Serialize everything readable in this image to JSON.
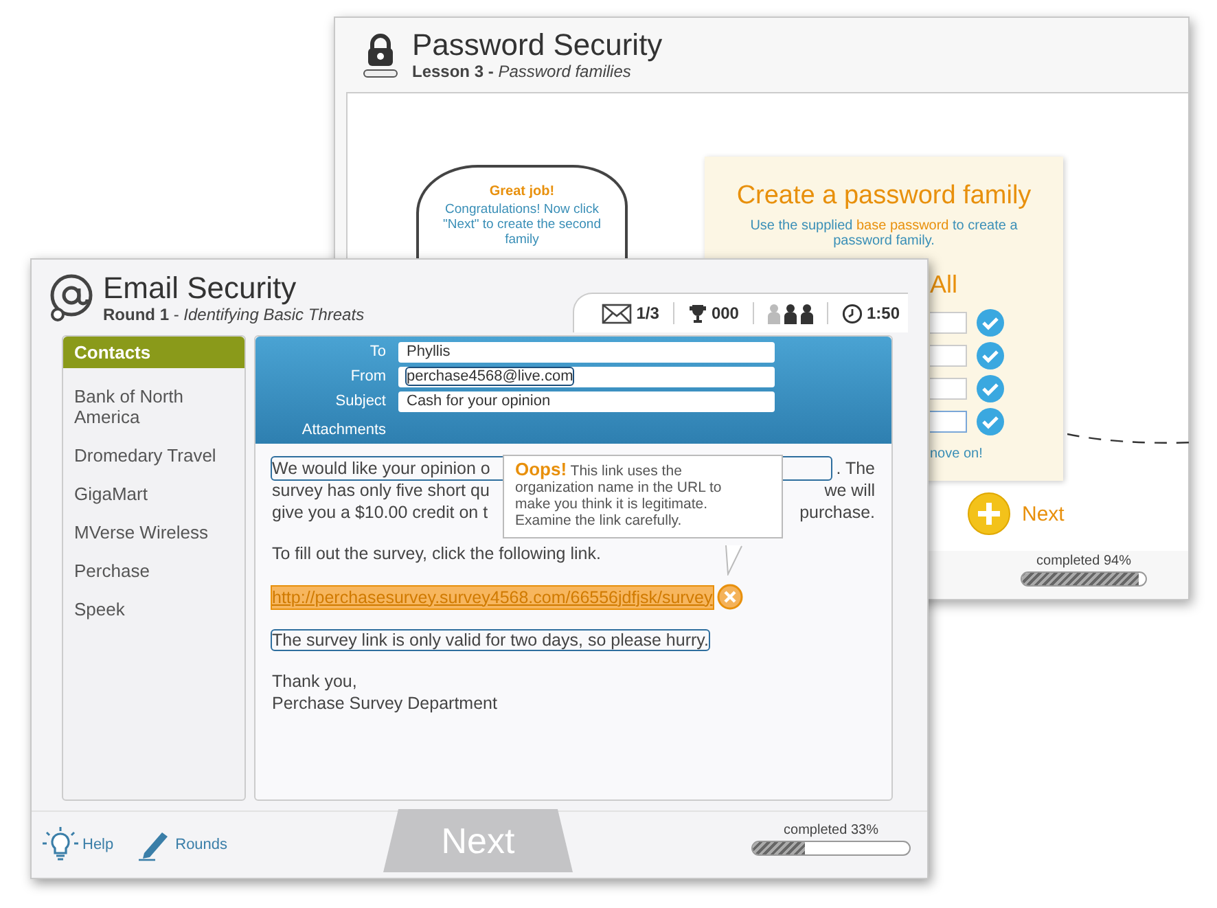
{
  "password_window": {
    "title": "Password Security",
    "subtitle": "**Lesson 3 -** *Password families*",
    "bubble": {
      "heading": "Great job!",
      "text": "Congratulations! Now click \"Next\" to create the second family"
    },
    "panel": {
      "title": "Create a password family",
      "instruction": [
        {
          "kind": "plain",
          "text": "Use the supplied "
        },
        {
          "kind": "term",
          "text": "base password"
        },
        {
          "kind": "plain",
          "text": " to create a password family."
        }
      ],
      "heading_fragment": "All",
      "inputs": [
        {
          "checked": true,
          "focused": false
        },
        {
          "checked": true,
          "focused": false
        },
        {
          "checked": true,
          "focused": false
        },
        {
          "checked": true,
          "focused": true
        }
      ],
      "note_fragment": "nove on!"
    },
    "next_button": "Next",
    "progress": {
      "label": "completed 94%",
      "level": 0.94
    }
  },
  "email_window": {
    "title": "Email Security",
    "subtitle": "**Round 1** - *Identifying Basic Threats*",
    "stats": [
      {
        "kind": "messages",
        "value": "1/3"
      },
      {
        "kind": "score",
        "value": "000"
      },
      {
        "kind": "lives",
        "lives": [
          {
            "active": false
          },
          {
            "active": true
          },
          {
            "active": true
          }
        ]
      },
      {
        "kind": "timer",
        "value": "1:50"
      }
    ],
    "contacts": {
      "header": "Contacts",
      "items": [
        {
          "name": "Bank of North America",
          "selected": false
        },
        {
          "name": "Dromedary Travel",
          "selected": false
        },
        {
          "name": "GigaMart",
          "selected": false
        },
        {
          "name": "MVerse Wireless",
          "selected": false
        },
        {
          "name": "Perchase",
          "selected": false
        },
        {
          "name": "Speek",
          "selected": false
        }
      ]
    },
    "fields": [
      {
        "kind": "field",
        "label": "To",
        "value": "Phyllis",
        "flagged": false
      },
      {
        "kind": "field",
        "label": "From",
        "value": "perchase4568@live.com",
        "flagged": true
      },
      {
        "kind": "field",
        "label": "Subject",
        "value": "Cash for your opinion",
        "flagged": false
      },
      {
        "kind": "label",
        "label": "Attachments"
      }
    ],
    "body": [
      {
        "kind": "covered",
        "lines": [
          {
            "left": "We would like your opinion o",
            "right": ". The",
            "outlined": true
          },
          {
            "left": "survey has only five short qu",
            "right": "we will",
            "outlined": false
          },
          {
            "left": "give you a $10.00 credit on t",
            "right": "purchase.",
            "outlined": false
          }
        ]
      },
      {
        "kind": "text",
        "text": "To fill out the survey, click the following link.",
        "outlined": false
      },
      {
        "kind": "link",
        "text": "http://perchasesurvey.survey4568.com/66556jdfjsk/survey",
        "flagged": true
      },
      {
        "kind": "text",
        "text": "The survey link is only valid for two days, so please hurry.",
        "outlined": true
      },
      {
        "kind": "signature",
        "lines": [
          "Thank you,",
          "Perchase Survey Department"
        ]
      }
    ],
    "tooltip": {
      "heading": "Oops!",
      "text": "This link uses the organization name in the URL to make you think it is legitimate. Examine the link carefully."
    },
    "footer": {
      "help": "Help",
      "rounds": "Rounds",
      "next": {
        "label": "Next",
        "disabled": true
      },
      "progress": {
        "label": "completed 33%",
        "level": 0.33
      }
    }
  }
}
